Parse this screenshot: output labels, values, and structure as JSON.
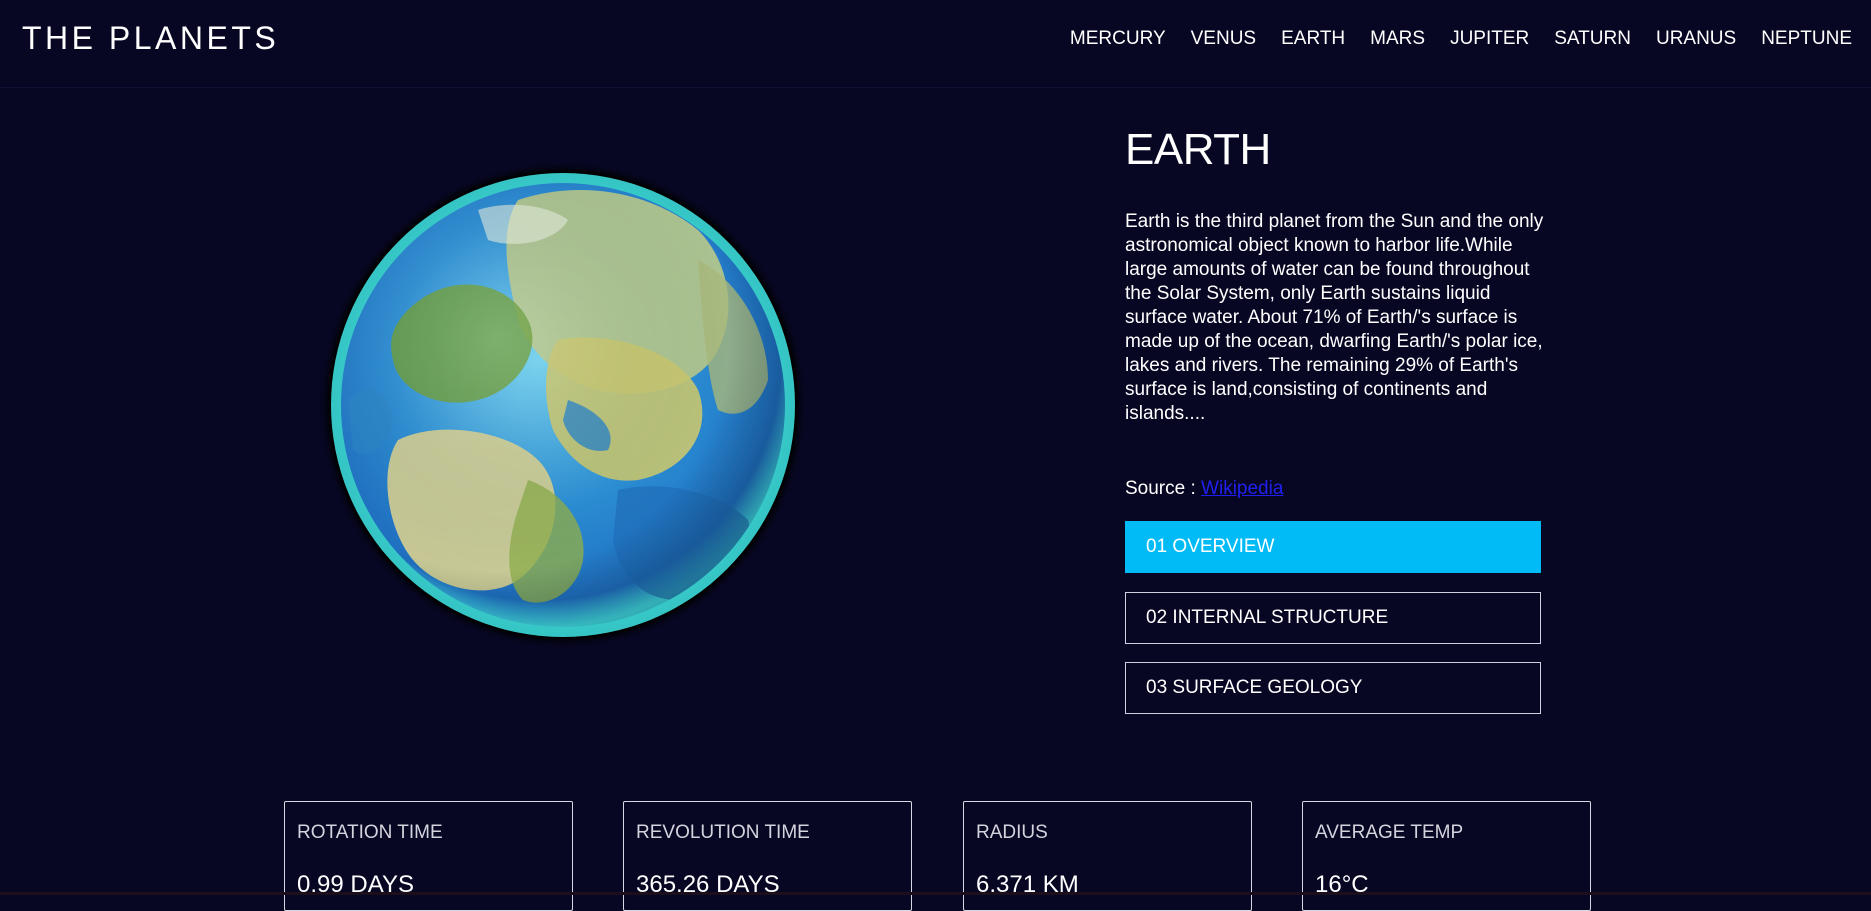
{
  "header": {
    "logo": "THE PLANETS",
    "nav": [
      "MERCURY",
      "VENUS",
      "EARTH",
      "MARS",
      "JUPITER",
      "SATURN",
      "URANUS",
      "NEPTUNE"
    ]
  },
  "planet": {
    "name": "EARTH",
    "description": "Earth is the third planet from the Sun and the only astronomical object known to harbor life.While large amounts of water can be found throughout the Solar System, only Earth sustains liquid surface water. About 71% of Earth/'s surface is made up of the ocean, dwarfing Earth/'s polar ice, lakes and rivers. The remaining 29% of Earth's surface is land,consisting of continents and islands....",
    "source_prefix": "Source : ",
    "source_link": "Wikipedia"
  },
  "tabs": [
    {
      "label": "01 OVERVIEW",
      "active": true
    },
    {
      "label": "02 INTERNAL STRUCTURE",
      "active": false
    },
    {
      "label": "03 SURFACE GEOLOGY",
      "active": false
    }
  ],
  "stats": [
    {
      "label": "ROTATION TIME",
      "value": "0.99 DAYS"
    },
    {
      "label": "REVOLUTION TIME",
      "value": "365.26 DAYS"
    },
    {
      "label": "RADIUS",
      "value": "6,371 KM"
    },
    {
      "label": "AVERAGE TEMP",
      "value": "16°C"
    }
  ],
  "colors": {
    "background": "#070724",
    "active_tab": "#00bbf5",
    "link": "#2020ee"
  }
}
